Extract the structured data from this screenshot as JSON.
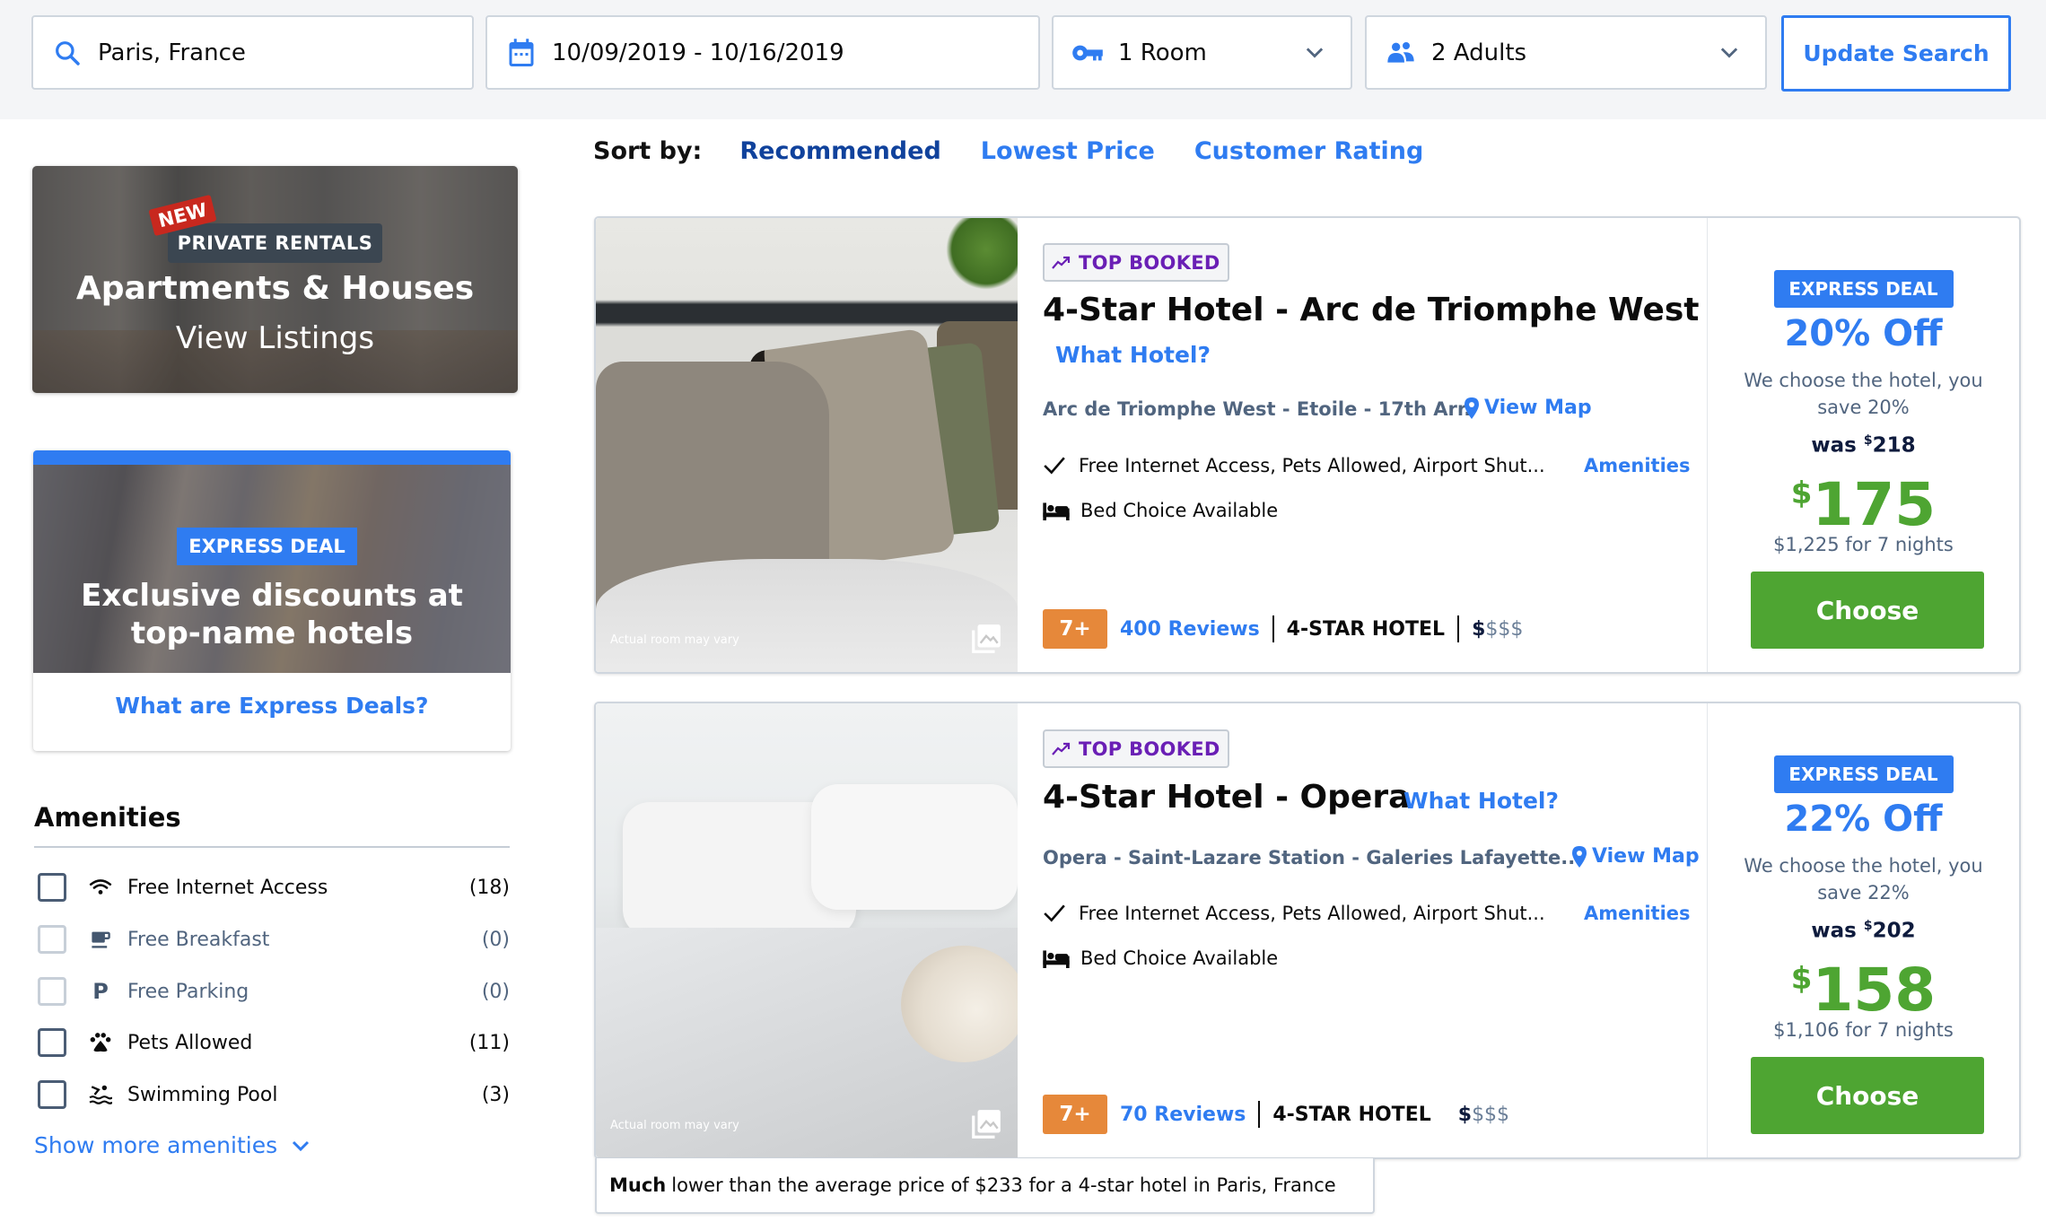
{
  "search": {
    "destination": "Paris, France",
    "dates": "10/09/2019 - 10/16/2019",
    "rooms": "1 Room",
    "guests": "2 Adults",
    "update_label": "Update Search"
  },
  "sort": {
    "label": "Sort by:",
    "options": [
      "Recommended",
      "Lowest Price",
      "Customer Rating"
    ],
    "active": "Recommended"
  },
  "promo_rentals": {
    "new_tag": "NEW",
    "tag": "PRIVATE RENTALS",
    "title": "Apartments & Houses",
    "subtitle": "View Listings"
  },
  "promo_express": {
    "tag": "EXPRESS DEAL",
    "title_line1": "Exclusive discounts at",
    "title_line2": "top-name hotels",
    "link": "What are Express Deals?"
  },
  "amenities": {
    "title": "Amenities",
    "items": [
      {
        "label": "Free Internet Access",
        "count": "(18)",
        "icon": "wifi-icon",
        "enabled": true
      },
      {
        "label": "Free Breakfast",
        "count": "(0)",
        "icon": "coffee-cup-icon",
        "enabled": false
      },
      {
        "label": "Free Parking",
        "count": "(0)",
        "icon": "parking-icon",
        "enabled": false
      },
      {
        "label": "Pets Allowed",
        "count": "(11)",
        "icon": "paw-icon",
        "enabled": true
      },
      {
        "label": "Swimming Pool",
        "count": "(3)",
        "icon": "swimmer-icon",
        "enabled": true
      }
    ],
    "show_more": "Show more amenities"
  },
  "hotels": [
    {
      "badge": "TOP BOOKED",
      "name": "4-Star Hotel - Arc de Triomphe West",
      "what_hotel": "What Hotel?",
      "area": "Arc de Triomphe West - Etoile - 17th Arr.",
      "view_map": "View Map",
      "amenities_text": "Free Internet Access, Pets Allowed, Airport Shut...",
      "amenities_link": "Amenities",
      "bed": "Bed Choice Available",
      "score": "7+",
      "reviews": "400 Reviews",
      "star_class": "4-STAR HOTEL",
      "price_level_on": "$",
      "price_level_off": "$$$",
      "image_caption": "Actual room may vary",
      "deal_tag": "EXPRESS DEAL",
      "pct_off": "20% Off",
      "choose_note": "We choose the hotel, you save 20%",
      "was_label": "was",
      "was_currency": "$",
      "was_price": "218",
      "currency": "$",
      "price": "175",
      "total": "$1,225 for 7 nights",
      "choose_label": "Choose"
    },
    {
      "badge": "TOP BOOKED",
      "name": "4-Star Hotel - Opera",
      "what_hotel": "What Hotel?",
      "area": "Opera - Saint-Lazare Station - Galeries Lafayette...",
      "view_map": "View Map",
      "amenities_text": "Free Internet Access, Pets Allowed, Airport Shut...",
      "amenities_link": "Amenities",
      "bed": "Bed Choice Available",
      "score": "7+",
      "reviews": "70 Reviews",
      "star_class": "4-STAR HOTEL",
      "price_level_on": "$",
      "price_level_off": "$$$",
      "image_caption": "Actual room may vary",
      "deal_tag": "EXPRESS DEAL",
      "pct_off": "22% Off",
      "choose_note": "We choose the hotel, you save 22%",
      "was_label": "was",
      "was_currency": "$",
      "was_price": "202",
      "currency": "$",
      "price": "158",
      "total": "$1,106 for 7 nights",
      "choose_label": "Choose"
    }
  ],
  "price_note": {
    "emphasis": "Much",
    "text": "lower than the average price of $233 for a 4-star hotel in Paris, France"
  },
  "colors": {
    "accent_blue": "#2f7cf1",
    "dark_blue": "#10429c",
    "price_green": "#4ea532",
    "badge_purple": "#6a1fb5",
    "score_orange": "#e6883a",
    "new_red": "#c8281e"
  }
}
